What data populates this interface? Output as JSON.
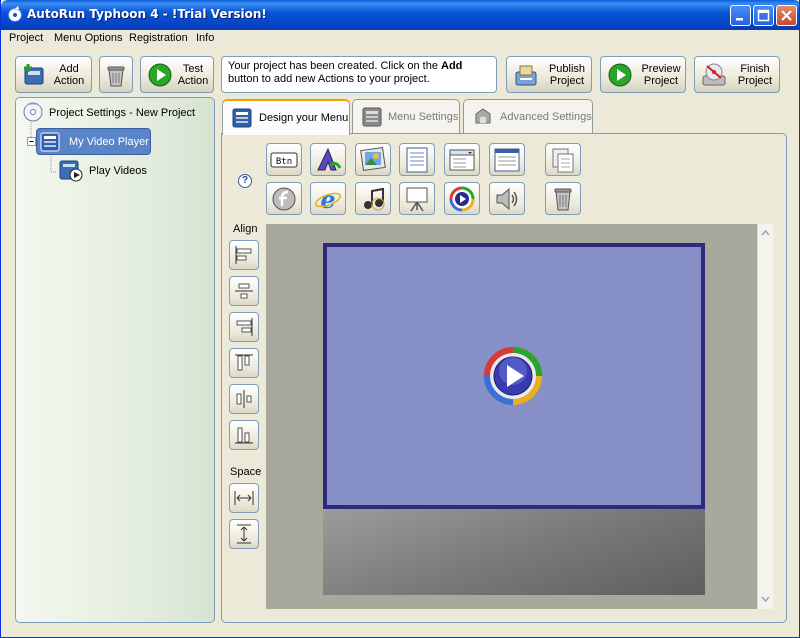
{
  "window": {
    "title": "AutoRun Typhoon 4 - !Trial Version!"
  },
  "menu": [
    "Project",
    "Menu Options",
    "Registration",
    "Info"
  ],
  "toolbar": {
    "add_action": "Add\nAction",
    "test_action": "Test\nAction",
    "publish_project": "Publish\nProject",
    "preview_project": "Preview\nProject",
    "finish_project": "Finish\nProject"
  },
  "message": {
    "before": "Your project has been created. Click on the ",
    "bold": "Add",
    "after": " button to add new Actions to your project."
  },
  "tree": {
    "root": "Project Settings - New Project",
    "menu_item": "My Video Player",
    "action_item": "Play Videos"
  },
  "tabs": [
    "Design your Menu",
    "Menu Settings",
    "Advanced Settings"
  ],
  "tool_icons": [
    "button-icon",
    "text-art-icon",
    "picture-icon",
    "text-block-icon",
    "listbox-icon",
    "browser-box-icon",
    "copy-icon",
    "flash-icon",
    "internet-explorer-icon",
    "music-icon",
    "slideshow-icon",
    "media-player-icon",
    "speaker-icon",
    "trash-icon"
  ],
  "button_tool_label": "Btn",
  "align": {
    "label": "Align",
    "space_label": "Space"
  },
  "help_symbol": "?",
  "colors": {
    "stage_fill": "#8890c8",
    "stage_border": "#2e2a80",
    "selected_tree_item": "#5a84c8"
  }
}
